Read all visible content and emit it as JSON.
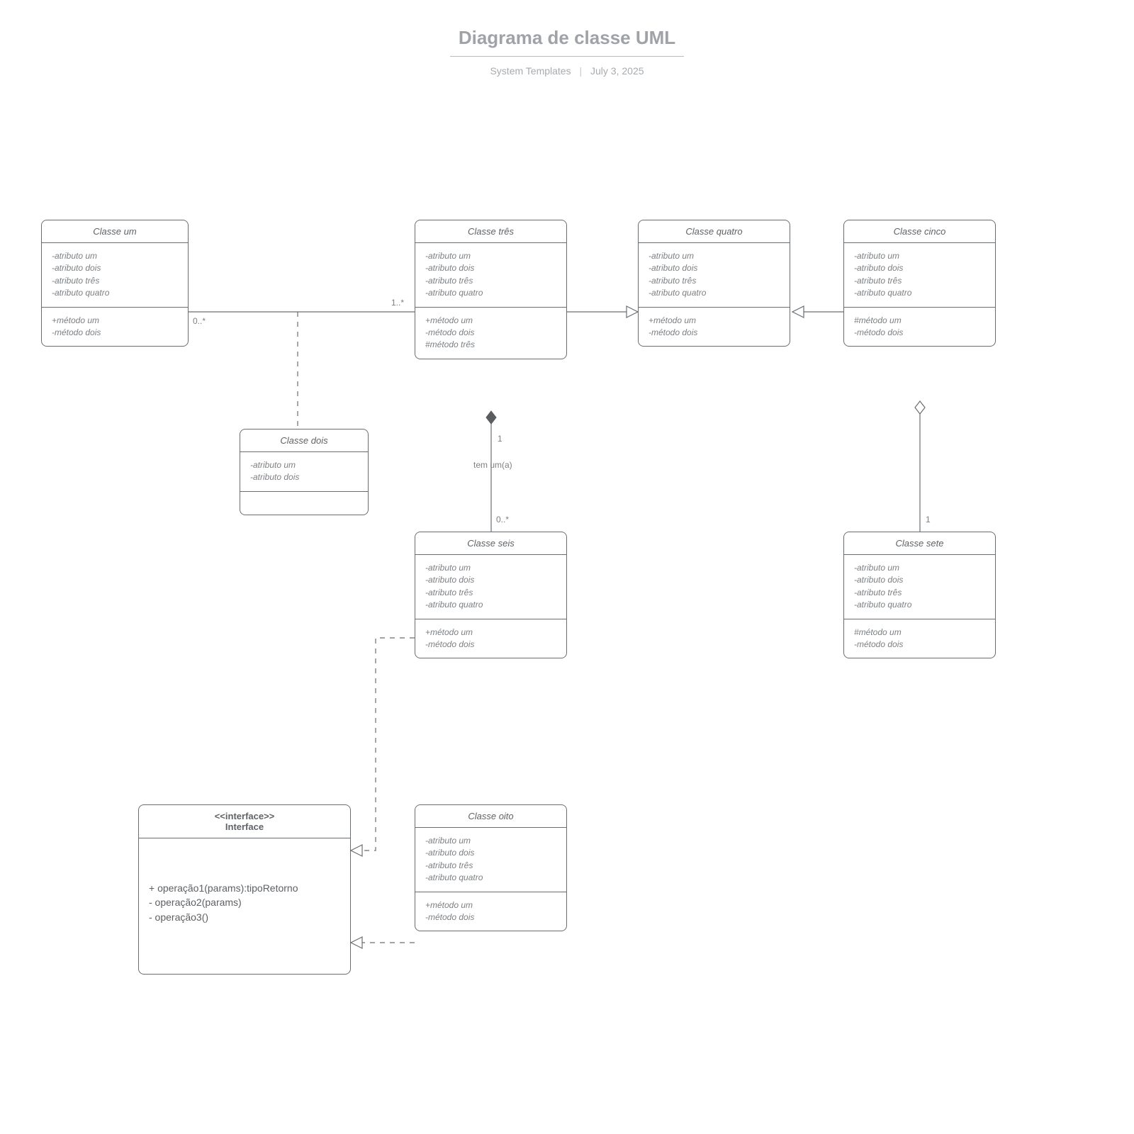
{
  "header": {
    "title": "Diagrama de classe UML",
    "author": "System Templates",
    "date": "July 3, 2025"
  },
  "classes": {
    "um": {
      "name": "Classe um",
      "attrs": [
        "-atributo um",
        "-atributo dois",
        "-atributo três",
        "-atributo quatro"
      ],
      "meths": [
        "+método um",
        "-método dois"
      ]
    },
    "dois": {
      "name": "Classe dois",
      "attrs": [
        "-atributo um",
        "-atributo dois"
      ],
      "meths": []
    },
    "tres": {
      "name": "Classe três",
      "attrs": [
        "-atributo um",
        "-atributo dois",
        "-atributo três",
        "-atributo quatro"
      ],
      "meths": [
        "+método um",
        "-método dois",
        "#método três"
      ]
    },
    "quatro": {
      "name": "Classe quatro",
      "attrs": [
        "-atributo um",
        "-atributo dois",
        "-atributo três",
        "-atributo quatro"
      ],
      "meths": [
        "+método um",
        "-método dois"
      ]
    },
    "cinco": {
      "name": "Classe cinco",
      "attrs": [
        "-atributo um",
        "-atributo dois",
        "-atributo três",
        "-atributo quatro"
      ],
      "meths": [
        "#método um",
        "-método dois"
      ]
    },
    "seis": {
      "name": "Classe seis",
      "attrs": [
        "-atributo um",
        "-atributo dois",
        "-atributo três",
        "-atributo quatro"
      ],
      "meths": [
        "+método um",
        "-método dois"
      ]
    },
    "sete": {
      "name": "Classe sete",
      "attrs": [
        "-atributo um",
        "-atributo dois",
        "-atributo três",
        "-atributo quatro"
      ],
      "meths": [
        "#método um",
        "-método dois"
      ]
    },
    "oito": {
      "name": "Classe oito",
      "attrs": [
        "-atributo um",
        "-atributo dois",
        "-atributo três",
        "-atributo quatro"
      ],
      "meths": [
        "+método um",
        "-método dois"
      ]
    }
  },
  "interface": {
    "stereotype": "<<interface>>",
    "name": "Interface",
    "ops": [
      "+ operação1(params):tipoRetorno",
      "- operação2(params)",
      "- operação3()"
    ]
  },
  "labels": {
    "m_0star": "0..*",
    "m_1star": "1..*",
    "m_1": "1",
    "m_0star_b": "0..*",
    "m_1_b": "1",
    "rel_name": "tem um(a)"
  }
}
